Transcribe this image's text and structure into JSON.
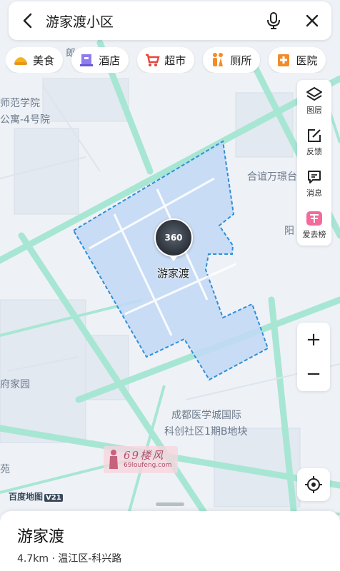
{
  "search": {
    "query": "游家渡小区"
  },
  "categories": [
    {
      "label": "美食",
      "icon": "food-icon"
    },
    {
      "label": "酒店",
      "icon": "hotel-icon"
    },
    {
      "label": "超市",
      "icon": "supermarket-icon"
    },
    {
      "label": "厕所",
      "icon": "toilet-icon"
    },
    {
      "label": "医院",
      "icon": "hospital-icon"
    }
  ],
  "tools": [
    {
      "label": "图层",
      "icon": "layers-icon"
    },
    {
      "label": "反馈",
      "icon": "feedback-icon"
    },
    {
      "label": "消息",
      "icon": "message-icon"
    },
    {
      "label": "爱去榜",
      "icon": "ranking-icon"
    }
  ],
  "zoom": {
    "in": "+",
    "out": "−"
  },
  "map": {
    "labels": {
      "normal_university": "师范学院",
      "apartment": "公寓-4号院",
      "mall": "合谊万璟台",
      "yang": "阳",
      "fujia": "府家园",
      "medical_city": "成都医学城国际",
      "tech_community": "科创社区1期B地块",
      "yuan": "苑",
      "partial_top": "郎"
    },
    "poi": {
      "name": "游家渡",
      "panorama_label": "360"
    },
    "logo": {
      "text": "百度地图",
      "version": "V21"
    },
    "watermark": {
      "line1": "69楼风",
      "line2": "69loufeng.com"
    },
    "colors": {
      "road": "#a8e6d4",
      "area_fill": "#c2d8f6",
      "area_border": "#2e8fd8",
      "background": "#eef2f6"
    }
  },
  "place": {
    "name": "游家渡",
    "detail": "4.7km · 温江区-科兴路"
  }
}
